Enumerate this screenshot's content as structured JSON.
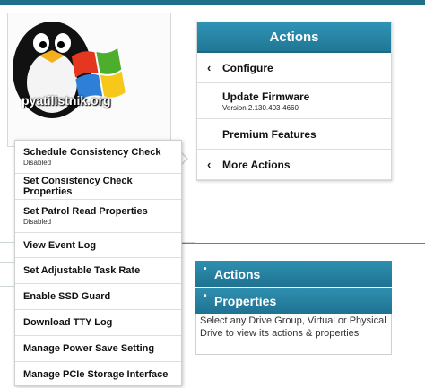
{
  "logo": {
    "text": "pyatilistnik.org"
  },
  "actions_panel": {
    "title": "Actions",
    "items": [
      {
        "label": "Configure",
        "chevron": "‹"
      },
      {
        "label": "Update Firmware",
        "sub": "Version 2.130.403-4660"
      },
      {
        "label": "Premium Features"
      },
      {
        "label": "More Actions",
        "chevron": "‹"
      }
    ]
  },
  "lower_panels": {
    "actions_title": "Actions",
    "properties_title": "Properties",
    "properties_text": "Select any Drive Group, Virtual or Physical Drive to view its actions & properties"
  },
  "context_menu": {
    "items": [
      {
        "label": "Schedule Consistency Check",
        "sub": "Disabled"
      },
      {
        "label": "Set Consistency Check Properties"
      },
      {
        "label": "Set Patrol Read Properties",
        "sub": "Disabled"
      },
      {
        "label": "View Event Log"
      },
      {
        "label": "Set Adjustable Task Rate"
      },
      {
        "label": "Enable SSD Guard"
      },
      {
        "label": "Download TTY Log"
      },
      {
        "label": "Manage Power Save Setting"
      },
      {
        "label": "Manage PCIe Storage Interface"
      }
    ]
  },
  "colors": {
    "header_blue": "#217795",
    "accent": "#2f93b4"
  }
}
